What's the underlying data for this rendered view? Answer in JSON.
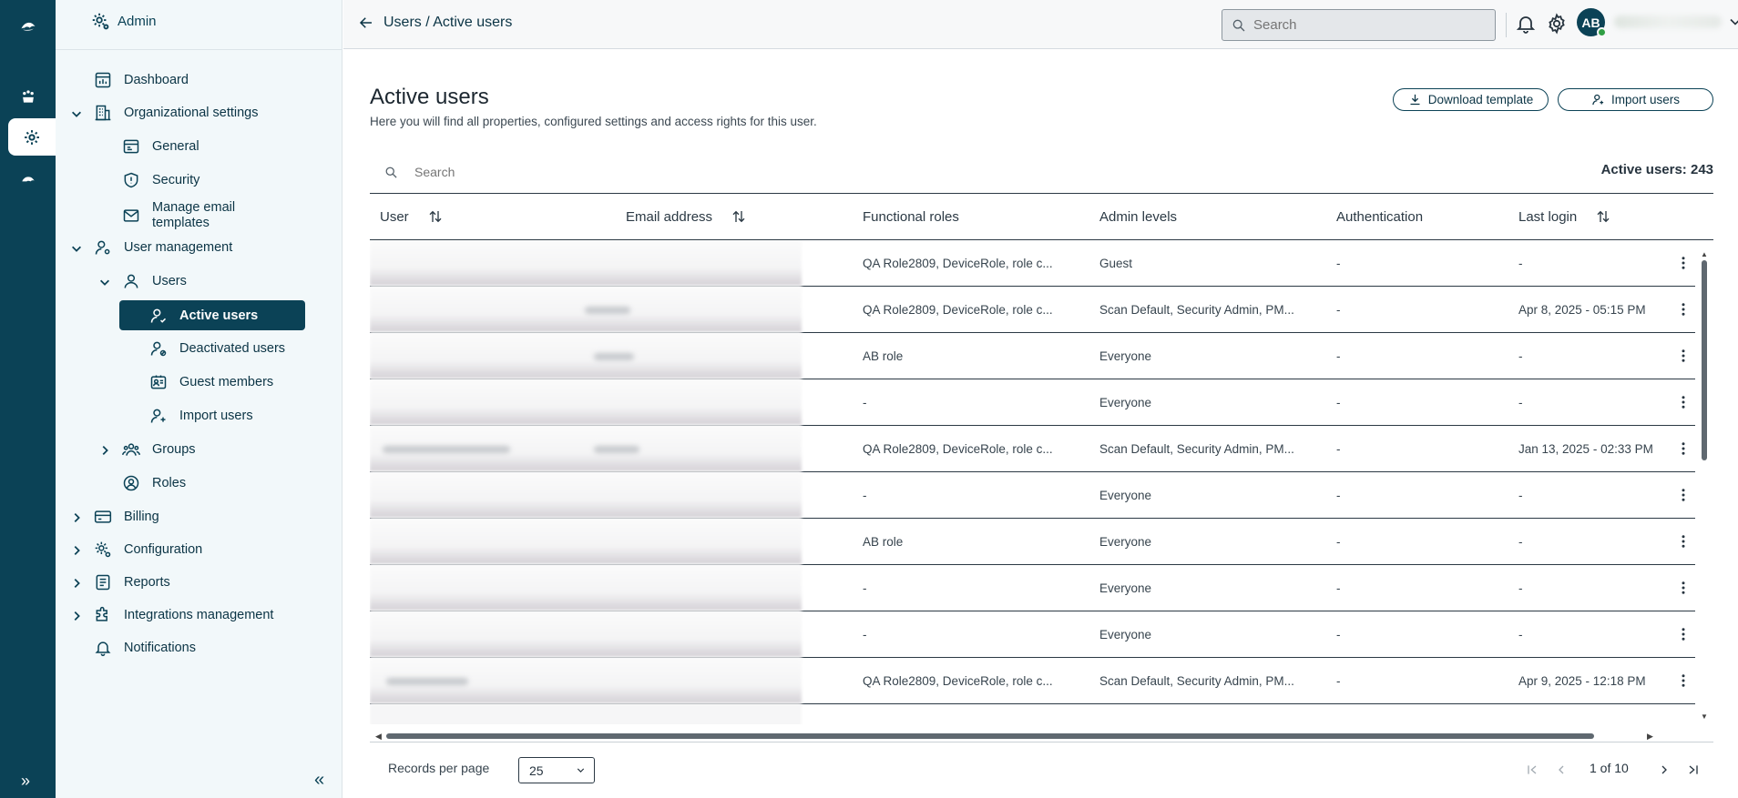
{
  "header": {
    "breadcrumb": "Users / Active users",
    "search_placeholder": "Search",
    "avatar_initials": "AB"
  },
  "sidenav": {
    "title": "Admin",
    "items": {
      "dashboard": "Dashboard",
      "org_settings": "Organizational settings",
      "general": "General",
      "security": "Security",
      "manage_email_1": "Manage email",
      "manage_email_2": "templates",
      "user_management": "User management",
      "users": "Users",
      "active_users": "Active users",
      "deactivated_users": "Deactivated users",
      "guest_members": "Guest members",
      "import_users": "Import users",
      "groups": "Groups",
      "roles": "Roles",
      "billing": "Billing",
      "configuration": "Configuration",
      "reports": "Reports",
      "integrations": "Integrations management",
      "notifications": "Notifications"
    }
  },
  "main": {
    "title": "Active users",
    "subtitle": "Here you will find all properties, configured settings and access rights for this user.",
    "download_template": "Download template",
    "import_users": "Import users",
    "table_search_placeholder": "Search",
    "count_label": "Active users: 243",
    "columns": {
      "user": "User",
      "email": "Email address",
      "roles": "Functional roles",
      "admin": "Admin levels",
      "auth": "Authentication",
      "login": "Last login"
    },
    "rows": [
      {
        "roles": "QA Role2809, DeviceRole, role c...",
        "admin": "Guest",
        "auth": "-",
        "login": "-"
      },
      {
        "roles": "QA Role2809, DeviceRole, role c...",
        "admin": "Scan Default, Security Admin, PM...",
        "auth": "-",
        "login": "Apr 8, 2025 - 05:15 PM"
      },
      {
        "roles": "AB role",
        "admin": "Everyone",
        "auth": "-",
        "login": "-"
      },
      {
        "roles": "-",
        "admin": "Everyone",
        "auth": "-",
        "login": "-"
      },
      {
        "roles": "QA Role2809, DeviceRole, role c...",
        "admin": "Scan Default, Security Admin, PM...",
        "auth": "-",
        "login": "Jan 13, 2025 - 02:33 PM"
      },
      {
        "roles": "-",
        "admin": "Everyone",
        "auth": "-",
        "login": "-"
      },
      {
        "roles": "AB role",
        "admin": "Everyone",
        "auth": "-",
        "login": "-"
      },
      {
        "roles": "-",
        "admin": "Everyone",
        "auth": "-",
        "login": "-"
      },
      {
        "roles": "-",
        "admin": "Everyone",
        "auth": "-",
        "login": "-"
      },
      {
        "roles": "QA Role2809, DeviceRole, role c...",
        "admin": "Scan Default, Security Admin, PM...",
        "auth": "-",
        "login": "Apr 9, 2025 - 12:18 PM"
      }
    ]
  },
  "footer": {
    "records_per_page_label": "Records per page",
    "records_per_page_value": "25",
    "page_indicator": "1 of 10"
  },
  "colors": {
    "brand": "#0b4256",
    "nav_bg": "#f2f8fa",
    "status_online": "#2f9e44"
  }
}
